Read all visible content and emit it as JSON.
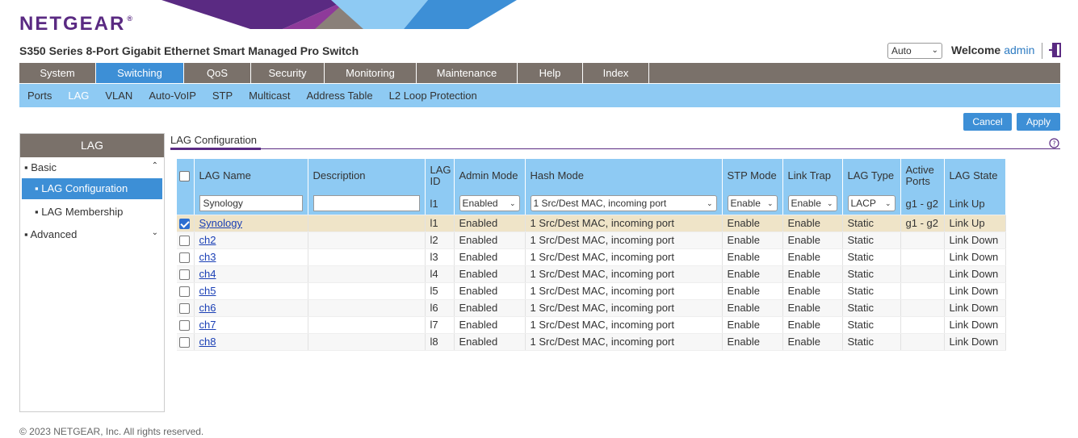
{
  "brand": {
    "logo": "NETGEAR",
    "logo_mark": "®"
  },
  "header": {
    "product": "S350 Series 8-Port Gigabit Ethernet Smart Managed Pro Switch",
    "language": "Auto",
    "welcome": "Welcome",
    "user": "admin"
  },
  "mainnav": [
    "System",
    "Switching",
    "QoS",
    "Security",
    "Monitoring",
    "Maintenance",
    "Help",
    "Index"
  ],
  "subnav": [
    "Ports",
    "LAG",
    "VLAN",
    "Auto-VoIP",
    "STP",
    "Multicast",
    "Address Table",
    "L2 Loop Protection"
  ],
  "buttons": {
    "cancel": "Cancel",
    "apply": "Apply"
  },
  "sidebar": {
    "title": "LAG",
    "basic": "Basic",
    "lag_configuration": "LAG Configuration",
    "lag_membership": "LAG Membership",
    "advanced": "Advanced"
  },
  "page_title": "LAG Configuration",
  "table": {
    "headers": [
      "LAG Name",
      "Description",
      "LAG ID",
      "Admin Mode",
      "Hash Mode",
      "STP Mode",
      "Link Trap",
      "LAG Type",
      "Active Ports",
      "LAG State"
    ],
    "edit_row": {
      "name": "Synology",
      "description": "",
      "id": "l1",
      "admin_mode": "Enabled",
      "hash_mode": "1 Src/Dest MAC, incoming port",
      "stp_mode": "Enable",
      "link_trap": "Enable",
      "lag_type": "LACP",
      "active_ports": "g1 - g2",
      "state": "Link Up"
    },
    "rows": [
      {
        "checked": true,
        "name": "Synology",
        "description": "",
        "id": "l1",
        "admin_mode": "Enabled",
        "hash_mode": "1 Src/Dest MAC, incoming port",
        "stp_mode": "Enable",
        "link_trap": "Enable",
        "lag_type": "Static",
        "active_ports": "g1 - g2",
        "state": "Link Up"
      },
      {
        "checked": false,
        "name": "ch2",
        "description": "",
        "id": "l2",
        "admin_mode": "Enabled",
        "hash_mode": "1 Src/Dest MAC, incoming port",
        "stp_mode": "Enable",
        "link_trap": "Enable",
        "lag_type": "Static",
        "active_ports": "",
        "state": "Link Down"
      },
      {
        "checked": false,
        "name": "ch3",
        "description": "",
        "id": "l3",
        "admin_mode": "Enabled",
        "hash_mode": "1 Src/Dest MAC, incoming port",
        "stp_mode": "Enable",
        "link_trap": "Enable",
        "lag_type": "Static",
        "active_ports": "",
        "state": "Link Down"
      },
      {
        "checked": false,
        "name": "ch4",
        "description": "",
        "id": "l4",
        "admin_mode": "Enabled",
        "hash_mode": "1 Src/Dest MAC, incoming port",
        "stp_mode": "Enable",
        "link_trap": "Enable",
        "lag_type": "Static",
        "active_ports": "",
        "state": "Link Down"
      },
      {
        "checked": false,
        "name": "ch5",
        "description": "",
        "id": "l5",
        "admin_mode": "Enabled",
        "hash_mode": "1 Src/Dest MAC, incoming port",
        "stp_mode": "Enable",
        "link_trap": "Enable",
        "lag_type": "Static",
        "active_ports": "",
        "state": "Link Down"
      },
      {
        "checked": false,
        "name": "ch6",
        "description": "",
        "id": "l6",
        "admin_mode": "Enabled",
        "hash_mode": "1 Src/Dest MAC, incoming port",
        "stp_mode": "Enable",
        "link_trap": "Enable",
        "lag_type": "Static",
        "active_ports": "",
        "state": "Link Down"
      },
      {
        "checked": false,
        "name": "ch7",
        "description": "",
        "id": "l7",
        "admin_mode": "Enabled",
        "hash_mode": "1 Src/Dest MAC, incoming port",
        "stp_mode": "Enable",
        "link_trap": "Enable",
        "lag_type": "Static",
        "active_ports": "",
        "state": "Link Down"
      },
      {
        "checked": false,
        "name": "ch8",
        "description": "",
        "id": "l8",
        "admin_mode": "Enabled",
        "hash_mode": "1 Src/Dest MAC, incoming port",
        "stp_mode": "Enable",
        "link_trap": "Enable",
        "lag_type": "Static",
        "active_ports": "",
        "state": "Link Down"
      }
    ]
  },
  "footer": "© 2023 NETGEAR, Inc. All rights reserved.",
  "colors": {
    "brand": "#5a2a82",
    "nav": "#7a716a",
    "accent": "#3d8fd6",
    "subnav": "#8ecaf3",
    "selected_row": "#efe4c8"
  }
}
